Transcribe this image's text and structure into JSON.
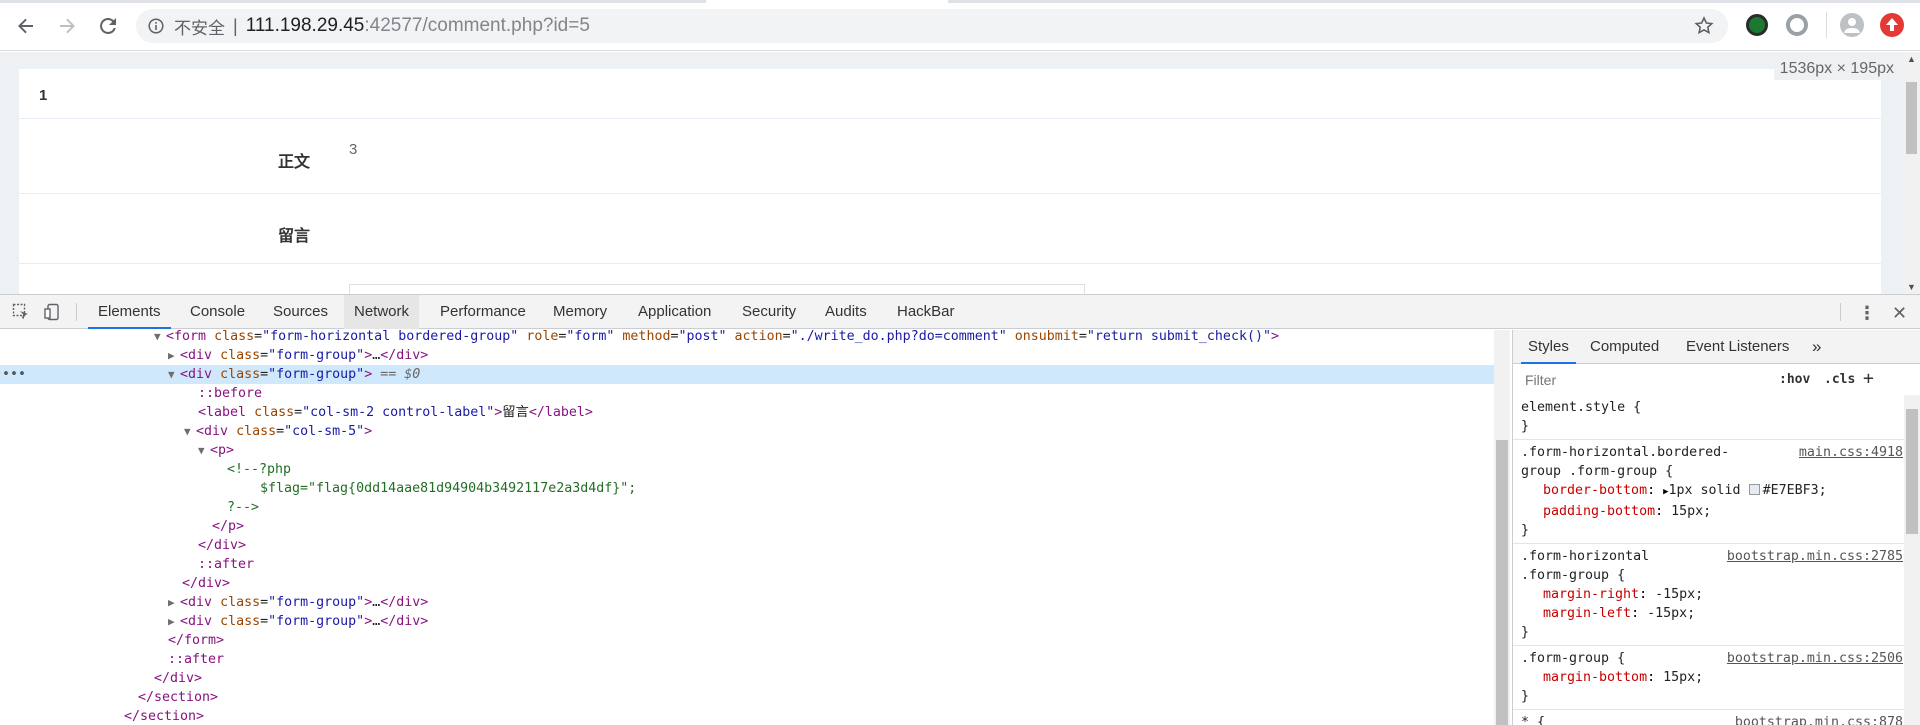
{
  "browser": {
    "security_label": "不安全",
    "url_host": "111.198.29.45",
    "url_rest": ":42577/comment.php?id=5"
  },
  "page": {
    "row1_number": "1",
    "body_label": "正文",
    "body_value": "3",
    "message_label": "留言",
    "dimension_overlay": "1536px × 195px"
  },
  "devtools": {
    "tabs": [
      "Elements",
      "Console",
      "Sources",
      "Network",
      "Performance",
      "Memory",
      "Application",
      "Security",
      "Audits",
      "HackBar"
    ],
    "active_tab": "Elements",
    "dom": {
      "form_open": "form",
      "form_attrs": [
        {
          "name": "class",
          "value": "\"form-horizontal bordered-group\""
        },
        {
          "name": "role",
          "value": "\"form\""
        },
        {
          "name": "method",
          "value": "\"post\""
        },
        {
          "name": "action",
          "value": "\"./write_do.php?do=comment\""
        },
        {
          "name": "onsubmit",
          "value": "\"return submit_check()\""
        }
      ],
      "div_tag": "div",
      "class_attr": "class",
      "form_group_value": "\"form-group\"",
      "collapsed_text": "…",
      "selected_marker": "== $0",
      "before": "::before",
      "after": "::after",
      "label_tag": "label",
      "label_class_value": "\"col-sm-2 control-label\"",
      "label_text": "留言",
      "col_class_value": "\"col-sm-5\"",
      "p_tag": "p",
      "comment_open": "<!--?php",
      "comment_flag": "$flag=\"flag{0dd14aae81d94904b3492117e2a3d4df}\";",
      "comment_close": "?-->",
      "close_p": "</p>",
      "close_div": "</div>",
      "close_form": "</form>",
      "close_section": "</section>",
      "dots": "•••"
    },
    "styles_tabs": [
      "Styles",
      "Computed",
      "Event Listeners"
    ],
    "more_tabs": "»",
    "filter_placeholder": "Filter",
    "hov": ":hov",
    "cls": ".cls",
    "add": "+",
    "rules": [
      {
        "selector": "element.style {",
        "source": "",
        "decls": [],
        "close": "}"
      },
      {
        "selector": ".form-horizontal.bordered-",
        "selector2": "group .form-group {",
        "source": "main.css:4918",
        "decls": [
          {
            "name": "border-bottom",
            "value": "1px solid",
            "color": "#E7EBF3;"
          },
          {
            "name": "padding-bottom",
            "value": "15px;"
          }
        ],
        "close": "}"
      },
      {
        "selector": ".form-horizontal",
        "selector2": ".form-group {",
        "source": "bootstrap.min.css:2785",
        "decls": [
          {
            "name": "margin-right",
            "value": "-15px;"
          },
          {
            "name": "margin-left",
            "value": "-15px;"
          }
        ],
        "close": "}"
      },
      {
        "selector": ".form-group {",
        "source": "bootstrap.min.css:2506",
        "decls": [
          {
            "name": "margin-bottom",
            "value": "15px;"
          }
        ],
        "close": "}"
      },
      {
        "selector": "* {",
        "source": "bootstrap.min.css:878",
        "decls": [],
        "close": ""
      }
    ]
  }
}
